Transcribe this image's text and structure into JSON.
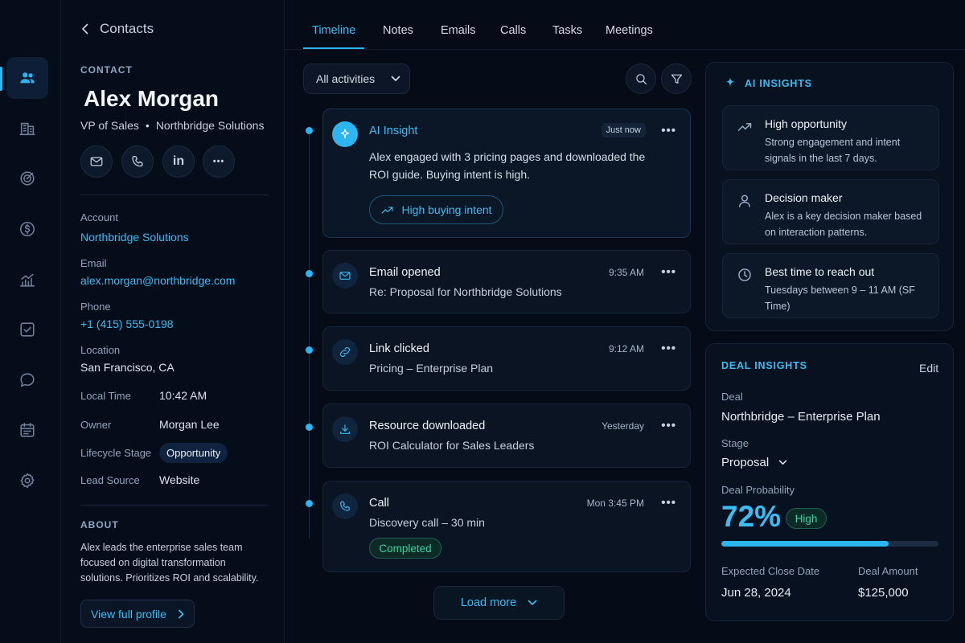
{
  "nav": {
    "items": [
      {
        "icon": "contacts-icon",
        "active": true
      },
      {
        "icon": "building-icon",
        "active": false
      },
      {
        "icon": "target-icon",
        "active": false
      },
      {
        "icon": "dollar-icon",
        "active": false
      },
      {
        "icon": "chart-icon",
        "active": false
      },
      {
        "icon": "tasks-icon",
        "active": false
      },
      {
        "icon": "chat-icon",
        "active": false
      },
      {
        "icon": "calendar-icon",
        "active": false
      },
      {
        "icon": "settings-icon",
        "active": false
      }
    ]
  },
  "contact": {
    "back_label": "Contacts",
    "section_label": "CONTACT",
    "name": "Alex Morgan",
    "title": "VP of Sales",
    "separator": "•",
    "company": "Northbridge Solutions",
    "actions": [
      "mail-icon",
      "phone-icon",
      "linkedin-icon",
      "more-icon"
    ],
    "linkedin_text": "in",
    "more_text": "•••",
    "fields": {
      "account_label": "Account",
      "account_value": "Northbridge Solutions",
      "email_label": "Email",
      "email_value": "alex.morgan@northbridge.com",
      "phone_label": "Phone",
      "phone_value": "+1 (415) 555-0198",
      "location_label": "Location",
      "location_value": "San Francisco, CA",
      "local_time_label": "Local Time",
      "local_time_value": "10:42 AM",
      "owner_label": "Owner",
      "owner_value": "Morgan Lee",
      "lifecycle_label": "Lifecycle Stage",
      "lifecycle_value": "Opportunity",
      "lead_source_label": "Lead Source",
      "lead_source_value": "Website"
    },
    "about_label": "ABOUT",
    "about_text": "Alex leads the enterprise sales team focused on digital transformation solutions. Prioritizes ROI and scalability.",
    "view_profile_label": "View full profile"
  },
  "tabs": [
    {
      "label": "Timeline",
      "active": true
    },
    {
      "label": "Notes",
      "active": false
    },
    {
      "label": "Emails",
      "active": false
    },
    {
      "label": "Calls",
      "active": false
    },
    {
      "label": "Tasks",
      "active": false
    },
    {
      "label": "Meetings",
      "active": false
    }
  ],
  "timeline": {
    "filter_label": "All activities",
    "ai_card": {
      "title": "AI Insight",
      "time": "Just now",
      "body": "Alex engaged with 3 pricing pages and downloaded the ROI guide. Buying intent is high.",
      "chip": "High buying intent"
    },
    "items": [
      {
        "icon": "mail-icon",
        "title": "Email opened",
        "subtitle": "Re: Proposal for Northbridge Solutions",
        "time": "9:35 AM"
      },
      {
        "icon": "link-icon",
        "title": "Link clicked",
        "subtitle": "Pricing – Enterprise Plan",
        "time": "9:12 AM"
      },
      {
        "icon": "download-icon",
        "title": "Resource downloaded",
        "subtitle": "ROI Calculator for Sales Leaders",
        "time": "Yesterday"
      },
      {
        "icon": "phone-icon",
        "title": "Call",
        "subtitle": "Discovery call – 30 min",
        "time": "Mon 3:45 PM",
        "status": "Completed"
      }
    ],
    "more_text": "•••",
    "load_more_label": "Load more"
  },
  "ai_insights": {
    "label": "AI INSIGHTS",
    "items": [
      {
        "icon": "trend-up-icon",
        "title": "High opportunity",
        "desc": "Strong engagement and intent signals in the last 7 days."
      },
      {
        "icon": "user-icon",
        "title": "Decision maker",
        "desc": "Alex is a key decision maker based on interaction patterns."
      },
      {
        "icon": "clock-icon",
        "title": "Best time to reach out",
        "desc": "Tuesdays between 9 – 11 AM (SF Time)"
      }
    ]
  },
  "deal_insights": {
    "label": "DEAL INSIGHTS",
    "edit_label": "Edit",
    "deal_label": "Deal",
    "deal_value": "Northbridge – Enterprise Plan",
    "stage_label": "Stage",
    "stage_value": "Proposal",
    "probability_label": "Deal Probability",
    "probability_value": "72%",
    "probability_fraction": 0.77,
    "probability_badge": "High",
    "close_date_label": "Expected Close Date",
    "close_date_value": "Jun 28, 2024",
    "amount_label": "Deal Amount",
    "amount_value": "$125,000"
  },
  "colors": {
    "accent": "#2cb5ef",
    "success": "#39d3a0",
    "background": "#050b17"
  }
}
